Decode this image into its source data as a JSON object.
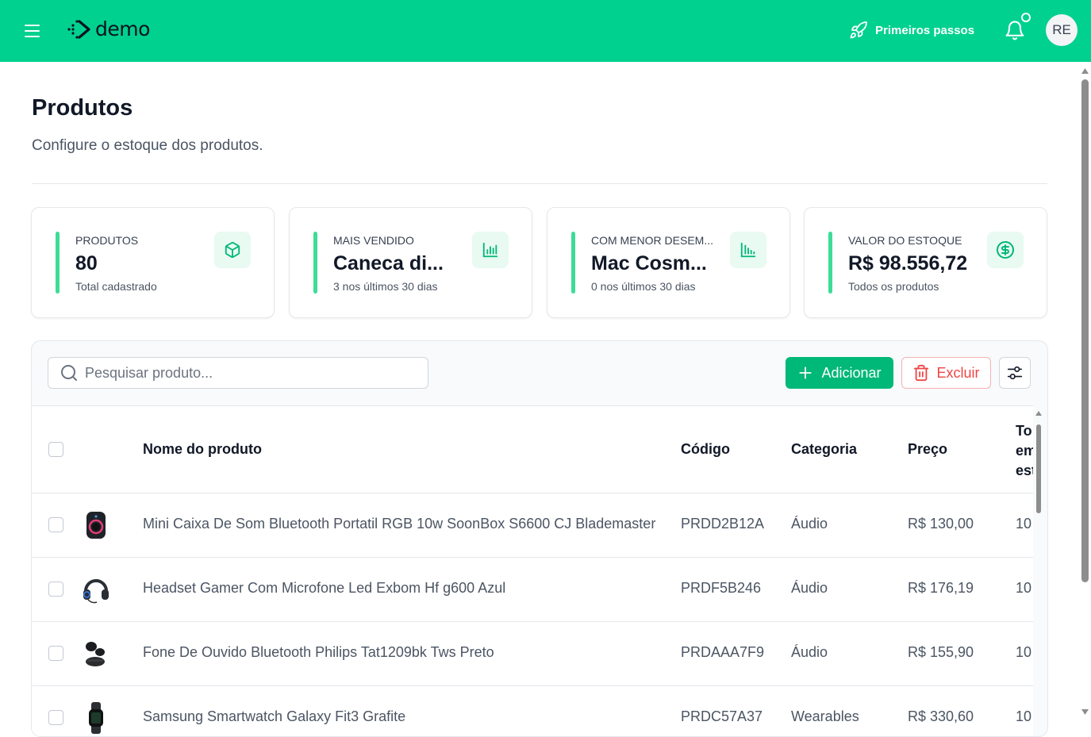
{
  "header": {
    "logo_text": "demo",
    "primeiros_label": "Primeiros passos",
    "avatar_initials": "RE",
    "brand_color": "#00d18e"
  },
  "page": {
    "title": "Produtos",
    "subtitle": "Configure o estoque dos produtos."
  },
  "cards": [
    {
      "label": "PRODUTOS",
      "value": "80",
      "note": "Total cadastrado",
      "icon": "box-icon"
    },
    {
      "label": "MAIS VENDIDO",
      "value": "Caneca di...",
      "note": "3 nos últimos 30 dias",
      "icon": "bar-chart-icon"
    },
    {
      "label": "COM MENOR DESEM...",
      "value": "Mac Cosm...",
      "note": "0 nos últimos 30 dias",
      "icon": "bar-chart-icon"
    },
    {
      "label": "VALOR DO ESTOQUE",
      "value": "R$ 98.556,72",
      "note": "Todos os produtos",
      "icon": "dollar-circle-icon"
    }
  ],
  "toolbar": {
    "search_placeholder": "Pesquisar produto...",
    "add_label": "Adicionar",
    "delete_label": "Excluir"
  },
  "table": {
    "columns": {
      "name": "Nome do produto",
      "code": "Código",
      "category": "Categoria",
      "price": "Preço",
      "total_line1": "To",
      "total_line2": "em",
      "total_line3": "est"
    },
    "rows": [
      {
        "name": "Mini Caixa De Som Bluetooth Portatil RGB 10w SoonBox S6600 CJ Blademaster",
        "code": "PRDD2B12A",
        "category": "Áudio",
        "price": "R$ 130,00",
        "total": "10",
        "thumb": "speaker-icon"
      },
      {
        "name": "Headset Gamer Com Microfone Led Exbom Hf g600 Azul",
        "code": "PRDF5B246",
        "category": "Áudio",
        "price": "R$ 176,19",
        "total": "10",
        "thumb": "headset-icon"
      },
      {
        "name": "Fone De Ouvido Bluetooth Philips Tat1209bk Tws Preto",
        "code": "PRDAAA7F9",
        "category": "Áudio",
        "price": "R$ 155,90",
        "total": "10",
        "thumb": "earbuds-icon"
      },
      {
        "name": "Samsung Smartwatch Galaxy Fit3 Grafite",
        "code": "PRDC57A37",
        "category": "Wearables",
        "price": "R$ 330,60",
        "total": "10",
        "thumb": "smartwatch-icon"
      }
    ]
  }
}
